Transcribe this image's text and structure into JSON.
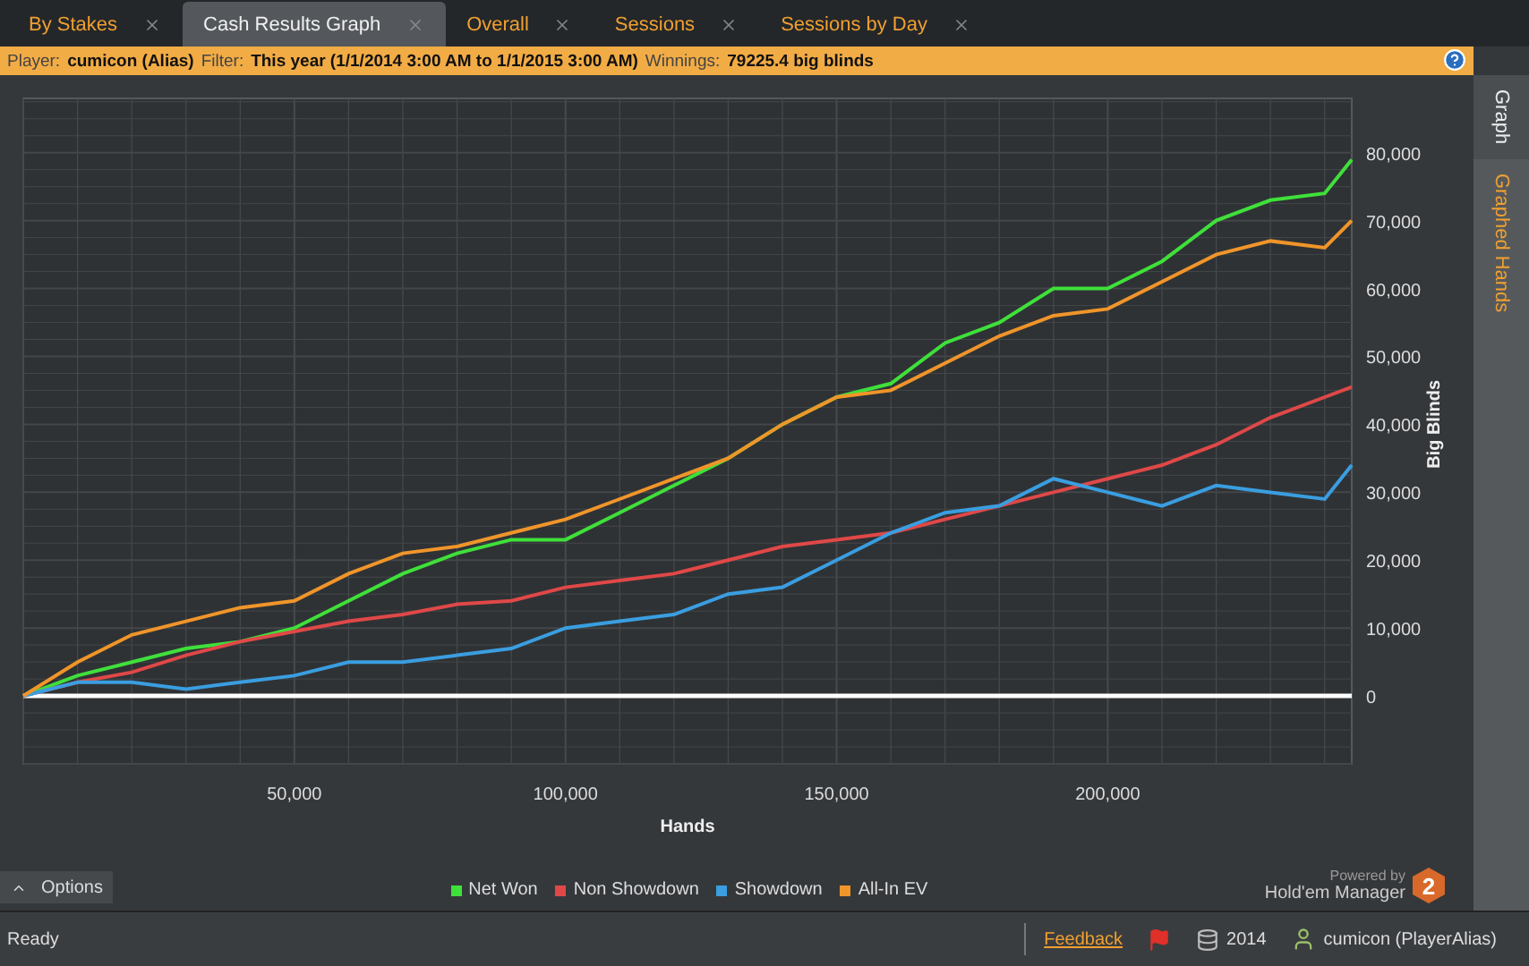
{
  "tabs": [
    {
      "label": "By Stakes",
      "selected": false
    },
    {
      "label": "Cash Results Graph",
      "selected": true
    },
    {
      "label": "Overall",
      "selected": false
    },
    {
      "label": "Sessions",
      "selected": false
    },
    {
      "label": "Sessions by Day",
      "selected": false
    }
  ],
  "info_bar": [
    {
      "label": "Player:",
      "value": "cumicon (Alias)"
    },
    {
      "label": "Filter:",
      "value": "This year (1/1/2014 3:00 AM to 1/1/2015 3:00 AM)"
    },
    {
      "label": "Winnings:",
      "value": "79225.4 big blinds"
    }
  ],
  "chart": {
    "chart_data": {
      "type": "line",
      "grid": true,
      "xlabel": "Hands",
      "ylabel": "Big Blinds",
      "x": [
        0,
        10000,
        20000,
        30000,
        40000,
        50000,
        60000,
        70000,
        80000,
        90000,
        100000,
        110000,
        120000,
        130000,
        140000,
        150000,
        160000,
        170000,
        180000,
        190000,
        200000,
        210000,
        220000,
        230000,
        240000,
        245000
      ],
      "xlim": [
        0,
        245000
      ],
      "ylim": [
        -10000,
        88000
      ],
      "xticks": [
        {
          "value": 50000,
          "label": "50,000"
        },
        {
          "value": 100000,
          "label": "100,000"
        },
        {
          "value": 150000,
          "label": "150,000"
        },
        {
          "value": 200000,
          "label": "200,000"
        }
      ],
      "yticks": [
        {
          "value": 0,
          "label": "0"
        },
        {
          "value": 10000,
          "label": "10,000"
        },
        {
          "value": 20000,
          "label": "20,000"
        },
        {
          "value": 30000,
          "label": "30,000"
        },
        {
          "value": 40000,
          "label": "40,000"
        },
        {
          "value": 50000,
          "label": "50,000"
        },
        {
          "value": 60000,
          "label": "60,000"
        },
        {
          "value": 70000,
          "label": "70,000"
        },
        {
          "value": 80000,
          "label": "80,000"
        }
      ],
      "series": [
        {
          "name": "Net Won",
          "color": "#3fe03a",
          "values": [
            0,
            3000,
            5000,
            7000,
            8000,
            10000,
            14000,
            18000,
            21000,
            23000,
            23000,
            27000,
            31000,
            35000,
            40000,
            44000,
            46000,
            52000,
            55000,
            60000,
            60000,
            64000,
            70000,
            73000,
            74000,
            79000
          ]
        },
        {
          "name": "Non Showdown",
          "color": "#e04848",
          "values": [
            0,
            2000,
            3500,
            6000,
            8000,
            9500,
            11000,
            12000,
            13500,
            14000,
            16000,
            17000,
            18000,
            20000,
            22000,
            23000,
            24000,
            26000,
            28000,
            30000,
            32000,
            34000,
            37000,
            41000,
            44000,
            45500
          ]
        },
        {
          "name": "Showdown",
          "color": "#3a9ee0",
          "values": [
            0,
            2000,
            2000,
            1000,
            2000,
            3000,
            5000,
            5000,
            6000,
            7000,
            10000,
            11000,
            12000,
            15000,
            16000,
            20000,
            24000,
            27000,
            28000,
            32000,
            30000,
            28000,
            31000,
            30000,
            29000,
            34000
          ]
        },
        {
          "name": "All-In EV",
          "color": "#f0952a",
          "values": [
            0,
            5000,
            9000,
            11000,
            13000,
            14000,
            18000,
            21000,
            22000,
            24000,
            26000,
            29000,
            32000,
            35000,
            40000,
            44000,
            45000,
            49000,
            53000,
            56000,
            57000,
            61000,
            65000,
            67000,
            66000,
            70000
          ]
        }
      ]
    }
  },
  "options_button": "Options",
  "logo": {
    "powered_by": "Powered by",
    "name": "Hold'em Manager",
    "badge": "2"
  },
  "side_tabs": [
    {
      "label": "Graph",
      "selected": true
    },
    {
      "label": "Graphed Hands",
      "selected": false
    }
  ],
  "status_bar": {
    "status": "Ready",
    "feedback": "Feedback",
    "year": "2014",
    "user": "cumicon (PlayerAlias)"
  }
}
